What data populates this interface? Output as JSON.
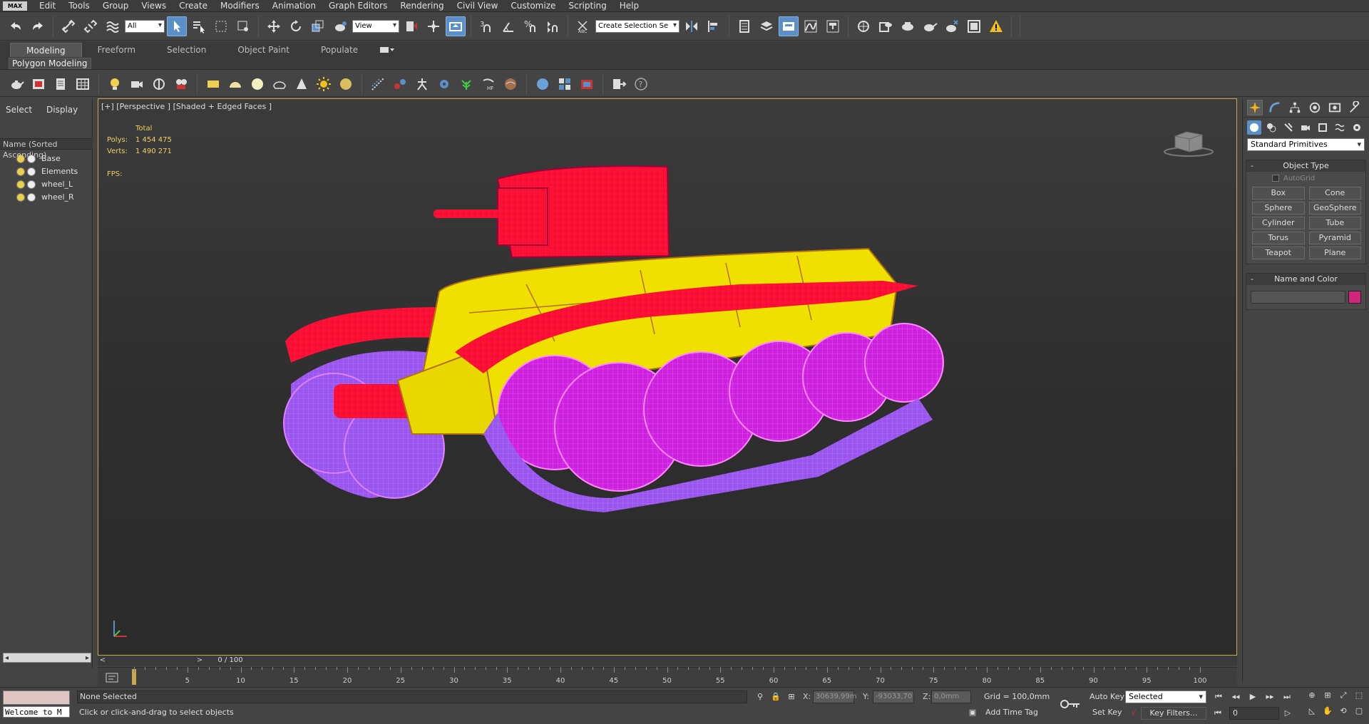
{
  "menu": {
    "logo": "MAX",
    "items": [
      "Edit",
      "Tools",
      "Group",
      "Views",
      "Create",
      "Modifiers",
      "Animation",
      "Graph Editors",
      "Rendering",
      "Civil View",
      "Customize",
      "Scripting",
      "Help"
    ]
  },
  "toolbar": {
    "filter_value": "All",
    "refcoord_value": "View",
    "selection_set_value": "Create Selection Se"
  },
  "ribbon": {
    "tabs": [
      "Modeling",
      "Freeform",
      "Selection",
      "Object Paint",
      "Populate"
    ],
    "active_tab": "Modeling",
    "subtab": "Polygon Modeling"
  },
  "explorer": {
    "tabs": [
      "Select",
      "Display"
    ],
    "column_header": "Name (Sorted Ascending)",
    "items": [
      "Base",
      "Elements",
      "wheel_L",
      "wheel_R"
    ]
  },
  "viewport": {
    "label": "[+] [Perspective ] [Shaded + Edged Faces ]",
    "stats_header": "Total",
    "polys_label": "Polys:",
    "polys_value": "1 454 475",
    "verts_label": "Verts:",
    "verts_value": "1 490 271",
    "fps_label": "FPS:",
    "colors": {
      "turret": "#ff1133",
      "hull": "#f0e000",
      "wheels": "#cc22dd",
      "tracks": "#9955ee"
    }
  },
  "command_panel": {
    "category_dropdown": "Standard Primitives",
    "object_type_title": "Object Type",
    "autogrid_label": "AutoGrid",
    "object_buttons": [
      "Box",
      "Cone",
      "Sphere",
      "GeoSphere",
      "Cylinder",
      "Tube",
      "Torus",
      "Pyramid",
      "Teapot",
      "Plane"
    ],
    "name_color_title": "Name and Color",
    "color_swatch": "#d0257a"
  },
  "timeline": {
    "slider_text": "0 / 100",
    "ticks": [
      "5",
      "10",
      "15",
      "20",
      "25",
      "30",
      "35",
      "40",
      "45",
      "50",
      "55",
      "60",
      "65",
      "70",
      "75",
      "80",
      "85",
      "90",
      "95",
      "100"
    ]
  },
  "status": {
    "listener_text": "Welcome to M",
    "selection_text": "None Selected",
    "prompt_text": "Click or click-and-drag to select objects",
    "x_label": "X:",
    "x_value": "30639,99m",
    "y_label": "Y:",
    "y_value": "-93033,70",
    "z_label": "Z:",
    "z_value": "0,0mm",
    "grid_text": "Grid = 100,0mm",
    "add_time_tag": "Add Time Tag",
    "auto_key": "Auto Key",
    "set_key": "Set Key",
    "selected_dropdown": "Selected",
    "key_filters": "Key Filters...",
    "frame_value": "0"
  }
}
